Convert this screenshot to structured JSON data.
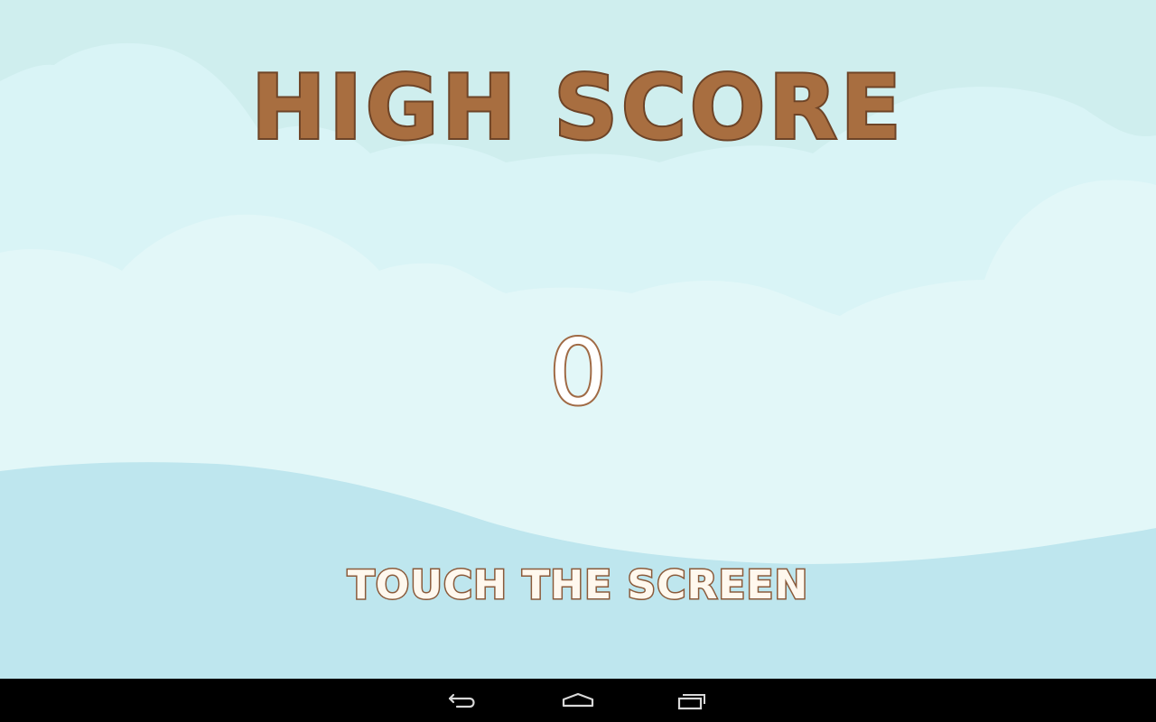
{
  "game": {
    "title": "HIGH SCORE",
    "score": "0",
    "prompt": "TOUCH THE SCREEN"
  },
  "colors": {
    "sky_top": "#CFEEEE",
    "cloud_far": "#D9F4F6",
    "cloud_mid": "#E2F7F8",
    "hill": "#BEE6EE",
    "title_fill": "#A86E40",
    "title_outline": "#6E4427",
    "score_fill": "#FFFFFF",
    "score_outline": "#A06A45",
    "navbar": "#000000",
    "nav_icon": "#D8D8D8"
  },
  "navigation_bar": {
    "buttons": [
      {
        "icon": "back-arrow-icon"
      },
      {
        "icon": "home-icon"
      },
      {
        "icon": "recent-apps-icon"
      }
    ]
  }
}
